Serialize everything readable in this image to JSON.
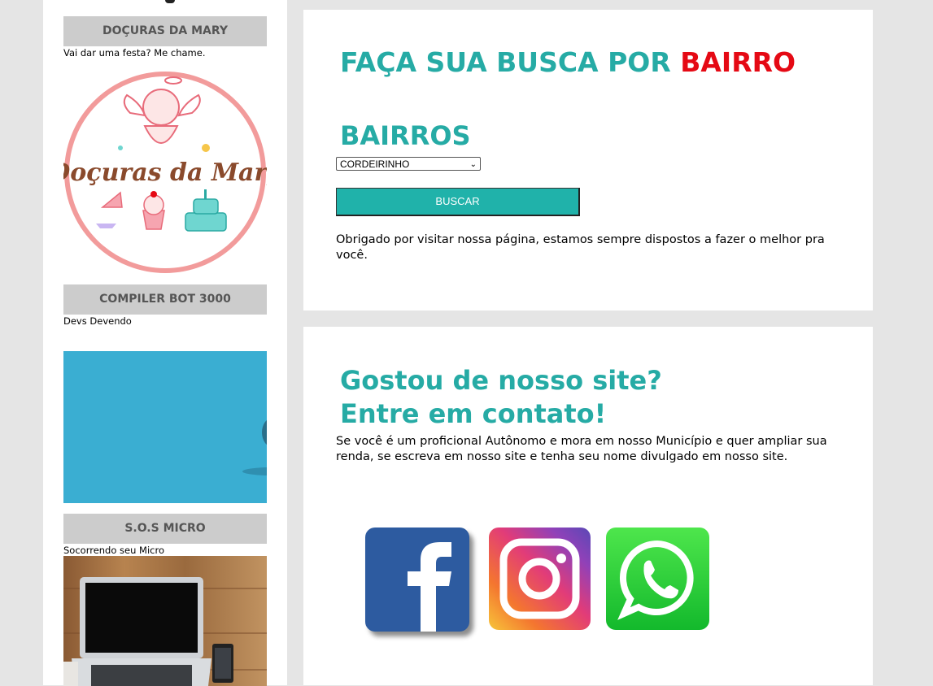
{
  "sidebar": {
    "cards": [
      {
        "title": "DOÇURAS DA MARY",
        "subtitle": "Vai dar uma festa? Me chame.",
        "logo_text": "Doçuras da Mary"
      },
      {
        "title": "COMPILER BOT 3000",
        "subtitle": "Devs Devendo"
      },
      {
        "title": "S.O.S MICRO",
        "subtitle": "Socorrendo seu Micro"
      }
    ]
  },
  "search": {
    "heading_part1": "FAÇA SUA BUSCA POR ",
    "heading_part2": "BAIRRO",
    "label": "BAIRROS",
    "selected": "CORDEIRINHO",
    "button": "BUSCAR",
    "thanks": "Obrigado por visitar nossa página, estamos sempre dispostos a fazer o melhor pra você."
  },
  "contact": {
    "heading_line1": "Gostou de nosso site?",
    "heading_line2": "Entre em contato!",
    "text": "Se você é um proficional Autônomo e mora em nosso Município e quer ampliar sua renda, se escreva em nosso site e tenha seu nome divulgado em nosso site.",
    "icons": [
      "facebook-icon",
      "instagram-icon",
      "whatsapp-icon"
    ]
  },
  "colors": {
    "teal": "#26aba5",
    "red": "#e50914",
    "button": "#20b2aa",
    "sidebar_title_bg": "#cccccc"
  }
}
